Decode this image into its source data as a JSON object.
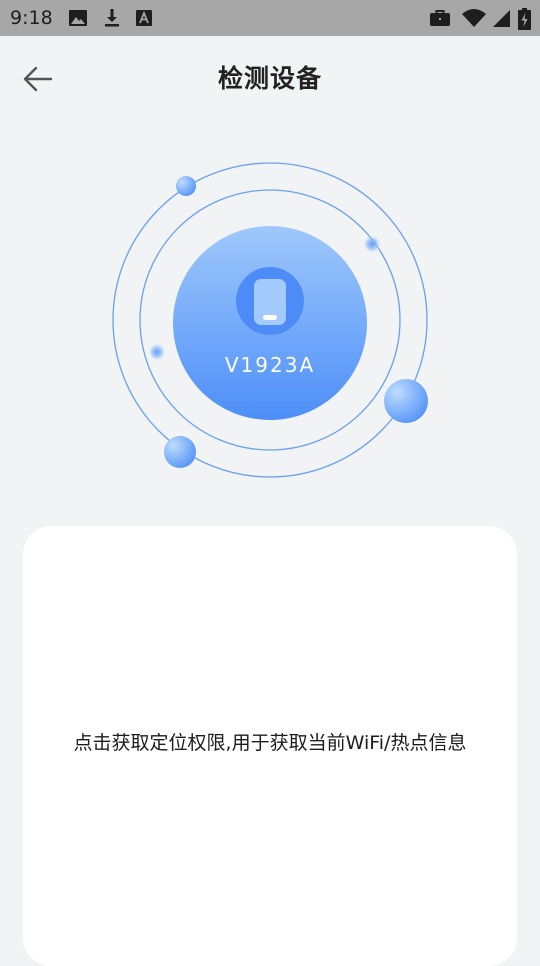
{
  "status_bar": {
    "time": "9:18",
    "icons": [
      "image-icon",
      "download-icon",
      "font-icon",
      "briefcase-icon",
      "wifi-icon",
      "signal-icon",
      "battery-icon"
    ]
  },
  "header": {
    "title": "检测设备",
    "back_icon": "arrow-left-icon"
  },
  "device": {
    "model": "V1923A",
    "icon": "phone-icon"
  },
  "card": {
    "message": "点击获取定位权限,用于获取当前WiFi/热点信息"
  },
  "colors": {
    "background": "#f2f3f5",
    "status_bar": "#a7a7a7",
    "accent": "#4a8af8",
    "orbit": "#6aa0f2",
    "card": "#ffffff"
  }
}
